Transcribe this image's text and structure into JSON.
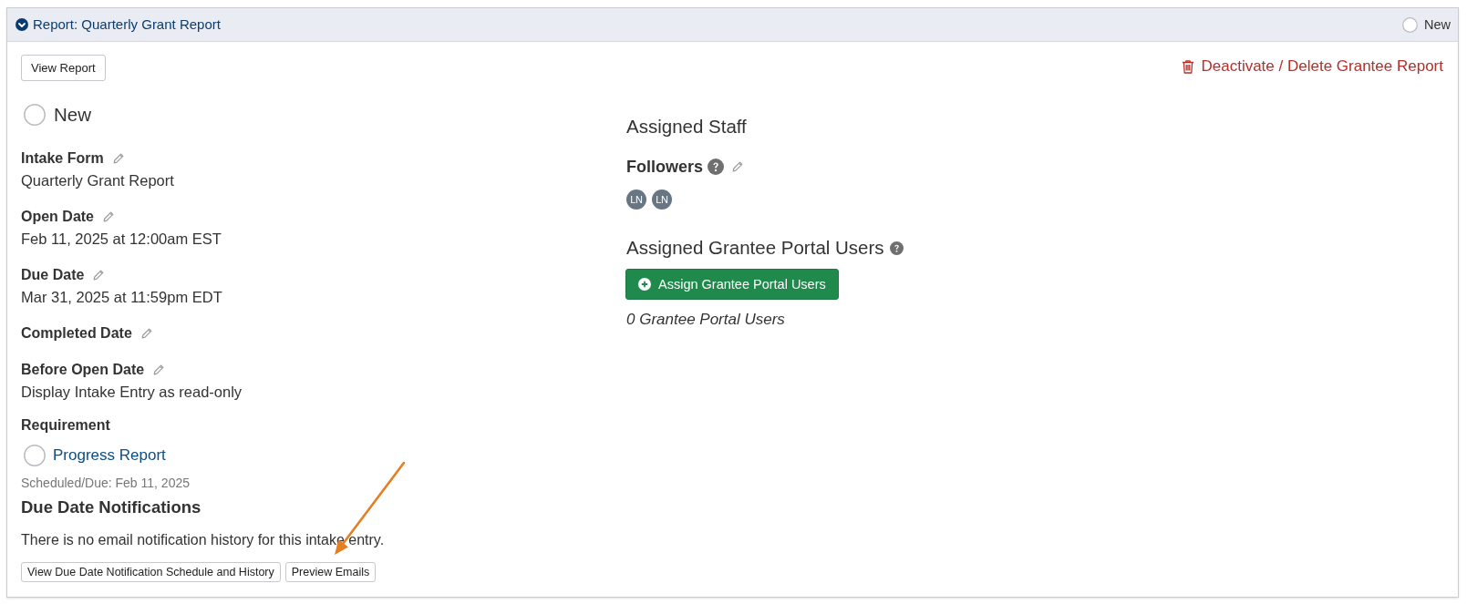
{
  "header": {
    "title": "Report: Quarterly Grant Report",
    "expanded": true,
    "status": "New"
  },
  "actions": {
    "view_button": "View Report",
    "delete_link": "Deactivate / Delete Grantee Report"
  },
  "status": "New",
  "fields": [
    {
      "label": "Intake Form",
      "value": "Quarterly Grant Report",
      "editable": true
    },
    {
      "label": "Open Date",
      "value": "Feb 11, 2025 at 12:00am EST",
      "editable": true
    },
    {
      "label": "Due Date",
      "value": "Mar 31, 2025 at 11:59pm EDT",
      "editable": true
    },
    {
      "label": "Completed Date",
      "editable": true
    },
    {
      "label": "Before Open Date",
      "value": "Display Intake Entry as read-only",
      "editable": true
    }
  ],
  "requirement": {
    "label": "Requirement",
    "name": "Progress Report",
    "schedule": "Scheduled/Due: Feb 11, 2025"
  },
  "notifications": {
    "title": "Due Date Notifications",
    "message": "There is no email notification history for this intake entry.",
    "buttons": [
      "View Due Date Notification Schedule and History",
      "Preview Emails"
    ]
  },
  "assigned_staff": {
    "title": "Assigned Staff"
  },
  "followers": {
    "label": "Followers",
    "help": true,
    "editable": true,
    "avatars": [
      "LN",
      "LN"
    ]
  },
  "portal_users": {
    "title": "Assigned Grantee Portal Users",
    "help": true,
    "button": "Assign Grantee Portal Users",
    "count": "0 Grantee Portal Users"
  }
}
